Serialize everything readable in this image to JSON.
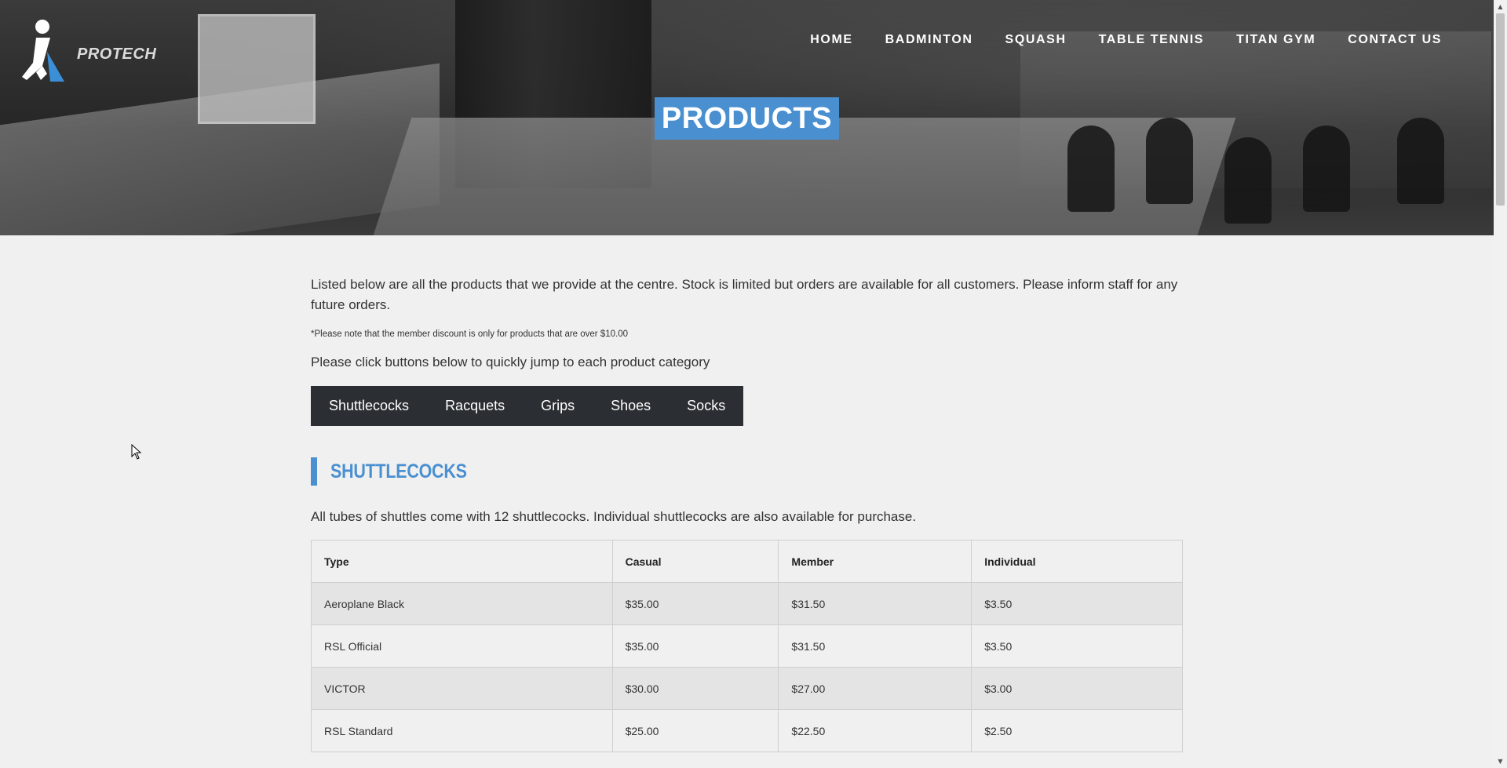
{
  "brand": {
    "logo_text": "PROTECH"
  },
  "nav": {
    "items": [
      {
        "label": "HOME"
      },
      {
        "label": "BADMINTON"
      },
      {
        "label": "SQUASH"
      },
      {
        "label": "TABLE TENNIS"
      },
      {
        "label": "TITAN GYM"
      },
      {
        "label": "CONTACT US"
      }
    ]
  },
  "hero": {
    "title": "PRODUCTS"
  },
  "main": {
    "intro": "Listed below are all the products that we provide at the centre. Stock is limited but orders are available for all customers. Please inform staff for any future orders.",
    "note": "*Please note that the member discount is only for products that are over $10.00",
    "jump_text": "Please click buttons below to quickly jump to each product category",
    "categories": [
      {
        "label": "Shuttlecocks"
      },
      {
        "label": "Racquets"
      },
      {
        "label": "Grips"
      },
      {
        "label": "Shoes"
      },
      {
        "label": "Socks"
      }
    ]
  },
  "shuttlecocks": {
    "heading": "SHUTTLECOCKS",
    "description": "All tubes of shuttles come with 12 shuttlecocks. Individual shuttlecocks are also available for purchase.",
    "columns": [
      "Type",
      "Casual",
      "Member",
      "Individual"
    ],
    "rows": [
      [
        "Aeroplane Black",
        "$35.00",
        "$31.50",
        "$3.50"
      ],
      [
        "RSL Official",
        "$35.00",
        "$31.50",
        "$3.50"
      ],
      [
        "VICTOR",
        "$30.00",
        "$27.00",
        "$3.00"
      ],
      [
        "RSL Standard",
        "$25.00",
        "$22.50",
        "$2.50"
      ]
    ]
  },
  "colors": {
    "accent": "#4a90d0",
    "catbar_bg": "#2b2f33"
  }
}
